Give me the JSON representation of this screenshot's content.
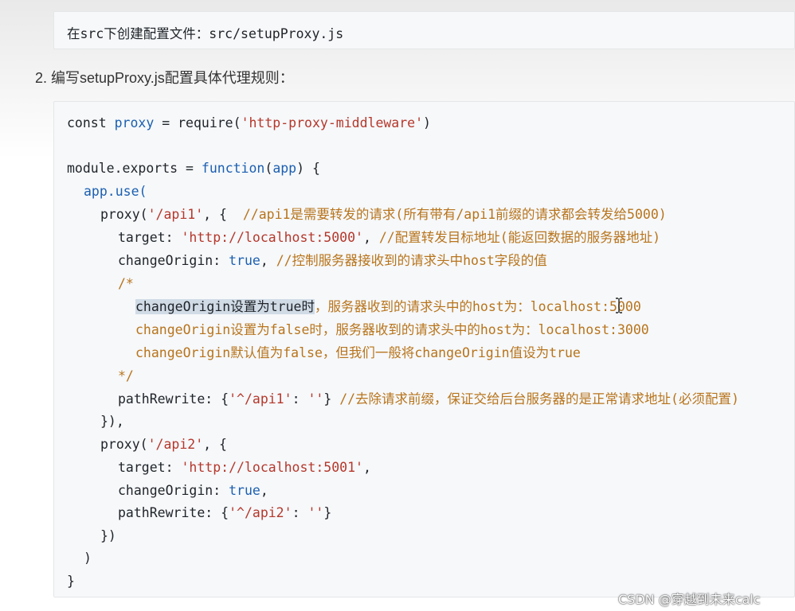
{
  "step1": {
    "code_line": "在src下创建配置文件：src/setupProxy.js"
  },
  "step2": {
    "heading": "2. 编写setupProxy.js配置具体代理规则："
  },
  "code": {
    "l1": {
      "a": "const ",
      "b": "proxy",
      "c": " = require(",
      "d": "'http-proxy-middleware'",
      "e": ")"
    },
    "l3": {
      "a": "module.exports = ",
      "b": "function",
      "c": "(",
      "d": "app",
      "e": ") {"
    },
    "l4": "app.use(",
    "l5": {
      "a": "proxy(",
      "b": "'/api1'",
      "c": ", {  ",
      "d": "//api1是需要转发的请求(所有带有/api1前缀的请求都会转发给5000)"
    },
    "l6": {
      "a": "target: ",
      "b": "'http://localhost:5000'",
      "c": ", ",
      "d": "//配置转发目标地址(能返回数据的服务器地址)"
    },
    "l7": {
      "a": "changeOrigin: ",
      "b": "true",
      "c": ", ",
      "d": "//控制服务器接收到的请求头中host字段的值"
    },
    "l8": "/*",
    "l9": {
      "a": "changeOrigin设置为true时",
      "b": "，服务器收到的请求头中的host为：localhost:5000"
    },
    "l10": "changeOrigin设置为false时，服务器收到的请求头中的host为：localhost:3000",
    "l11": "changeOrigin默认值为false，但我们一般将changeOrigin值设为true",
    "l12": "*/",
    "l13": {
      "a": "pathRewrite: {",
      "b": "'^/api1'",
      "c": ": ",
      "d": "''",
      "e": "} ",
      "f": "//去除请求前缀，保证交给后台服务器的是正常请求地址(必须配置)"
    },
    "l14": "}),",
    "l15": {
      "a": "proxy(",
      "b": "'/api2'",
      "c": ", {"
    },
    "l16": {
      "a": "target: ",
      "b": "'http://localhost:5001'",
      "c": ","
    },
    "l17": {
      "a": "changeOrigin: ",
      "b": "true",
      "c": ","
    },
    "l18": {
      "a": "pathRewrite: {",
      "b": "'^/api2'",
      "c": ": ",
      "d": "''",
      "e": "}"
    },
    "l19": "})",
    "l20": ")",
    "l21": "}"
  },
  "icons": {
    "cursor": "text-cursor-icon"
  },
  "watermark": "CSDN @穿越到未来calc"
}
